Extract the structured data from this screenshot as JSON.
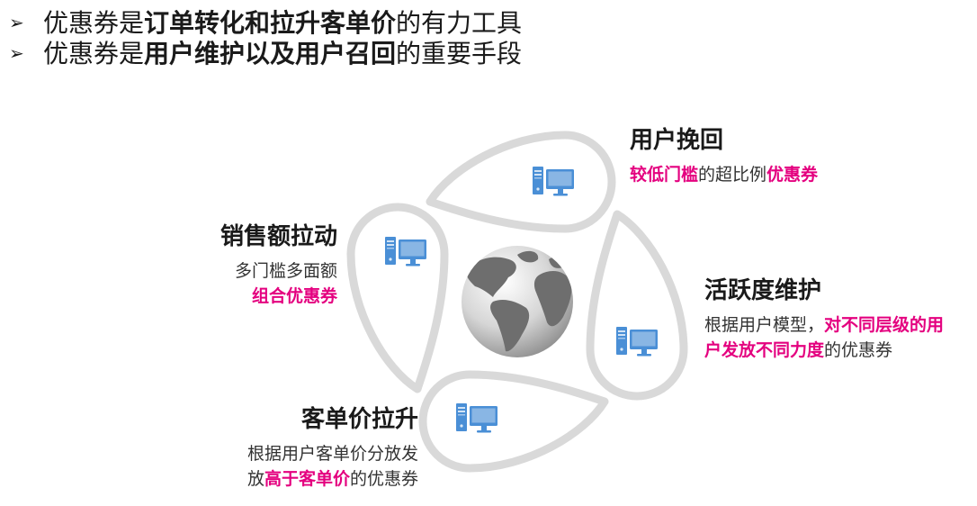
{
  "colors": {
    "accent": "#e4007f",
    "text": "#1a1a1a",
    "desc": "#333333",
    "icon": "#4a8fd6",
    "petal_stroke": "#d9d9d9",
    "globe_land": "#6e6e6e"
  },
  "icons": {
    "bullet": "arrow-bullet-icon",
    "feature": "computer-icon",
    "center": "globe-icon"
  },
  "bullets": [
    {
      "marker": "➢",
      "prefix": "优惠券是",
      "highlight": "订单转化和拉升客单价",
      "suffix": "的有力工具"
    },
    {
      "marker": "➢",
      "prefix": "优惠券是",
      "highlight": "用户维护以及用户召回",
      "suffix": "的重要手段"
    }
  ],
  "features": [
    {
      "title": "用户挽回",
      "lines": [
        [
          "较低门槛",
          "的超比例",
          "优惠券"
        ]
      ]
    },
    {
      "title": "销售额拉动",
      "lines": [
        [
          "多门槛多面额"
        ],
        [
          "组合优惠券"
        ]
      ]
    },
    {
      "title": "活跃度维护",
      "lines": [
        [
          "根据用户模型，",
          "对不同层级的用"
        ],
        [
          "户发放不同力度",
          "的优惠券"
        ]
      ]
    },
    {
      "title": "客单价拉升",
      "lines": [
        [
          "根据用户客单价分放发"
        ],
        [
          "放",
          "高于客单价",
          "的优惠券"
        ]
      ]
    }
  ]
}
